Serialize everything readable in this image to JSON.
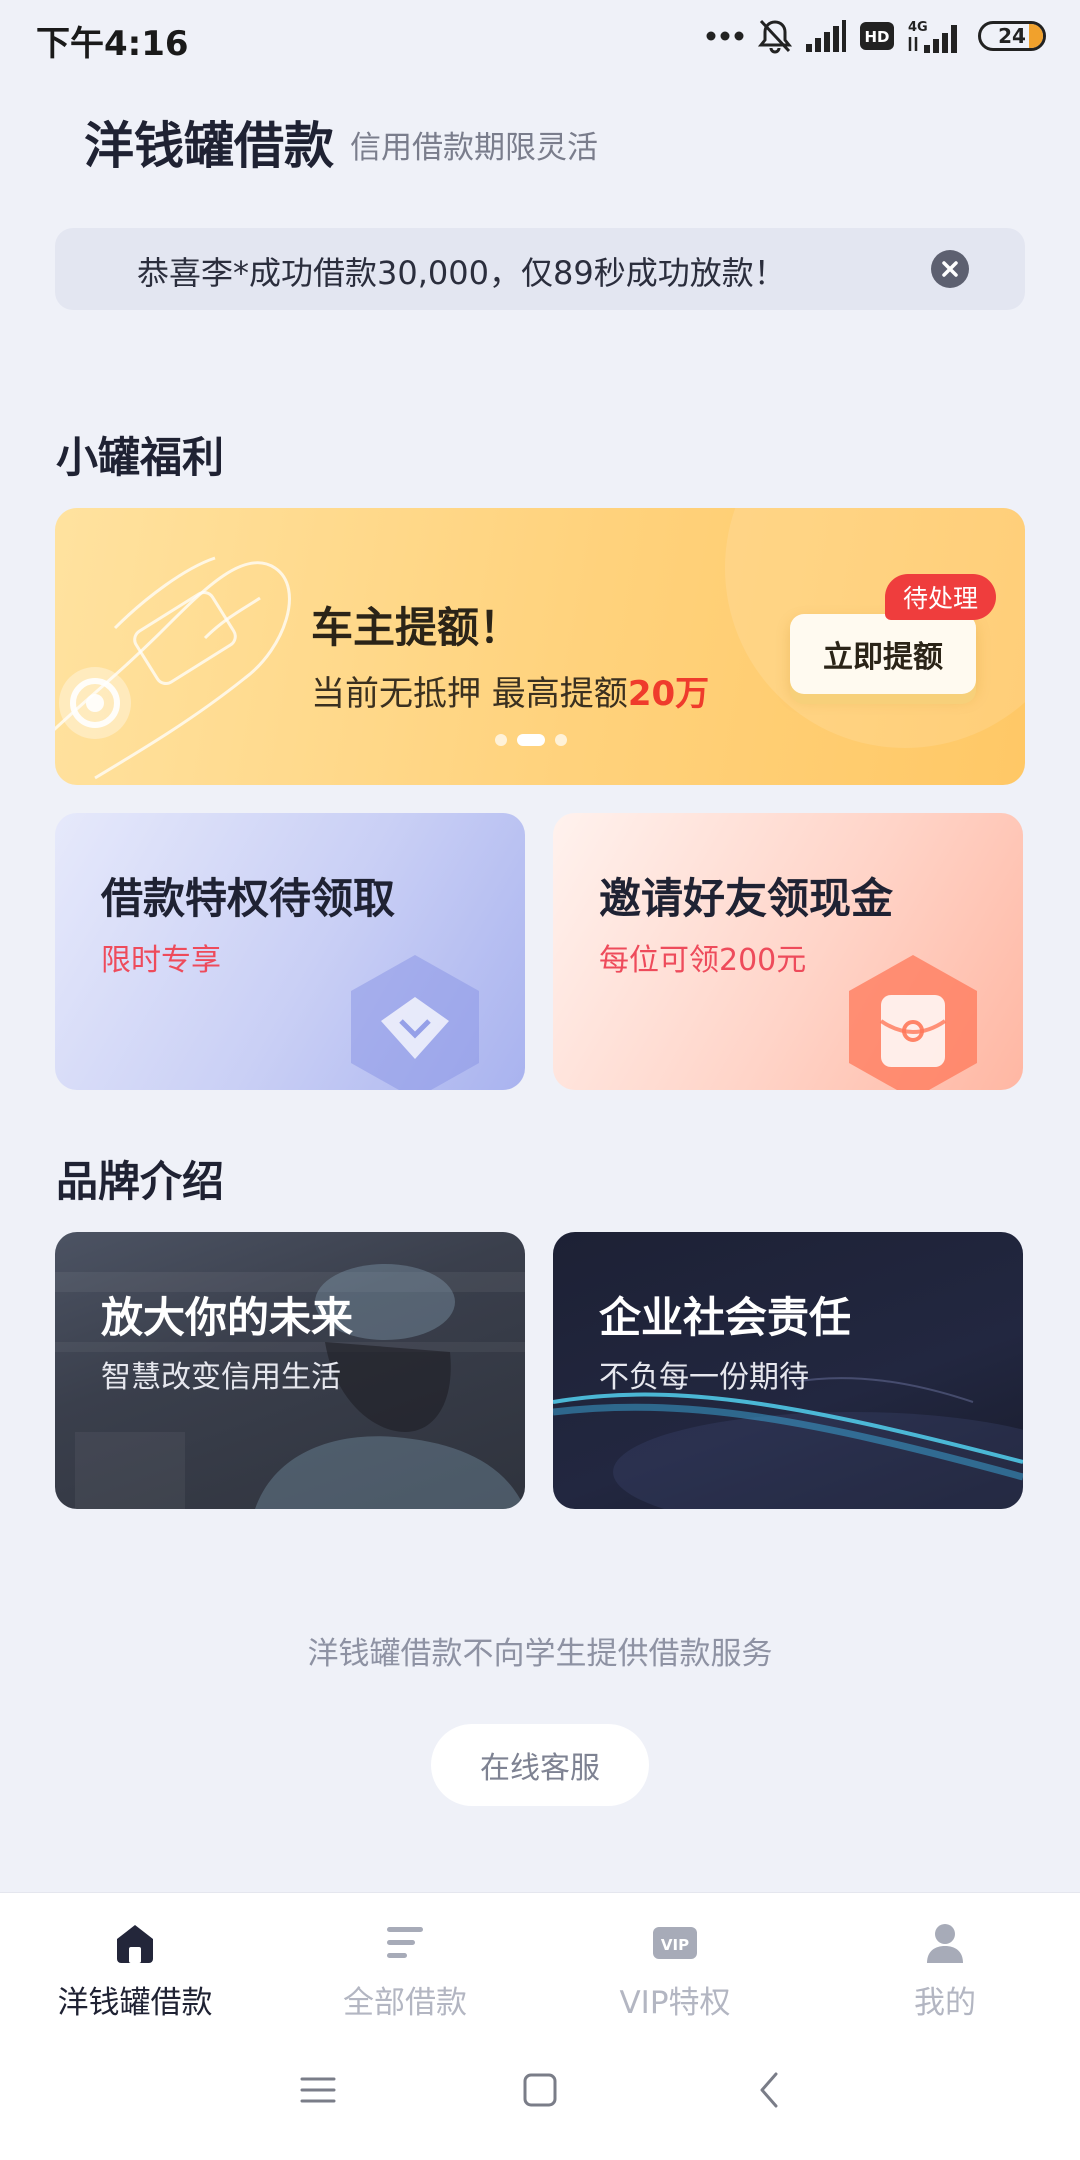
{
  "status_bar": {
    "time": "下午4:16",
    "network_label": "4G",
    "hd_label": "HD",
    "battery_level": "24",
    "icons": [
      "more-dots-icon",
      "mute-bell-icon",
      "signal-icon",
      "hd-icon",
      "signal-4g-icon",
      "battery-icon"
    ]
  },
  "header": {
    "title": "洋钱罐借款",
    "subtitle": "信用借款期限灵活"
  },
  "notice": {
    "text": "恭喜李*成功借款30,000，仅89秒成功放款！"
  },
  "welfare": {
    "section_title": "小罐福利",
    "banner": {
      "title": "车主提额！",
      "desc_prefix": "当前无抵押 最高提额",
      "desc_highlight": "20万",
      "button_label": "立即提额",
      "tag_label": "待处理",
      "page_count": 3,
      "active_page": 1
    },
    "cards": [
      {
        "title": "借款特权待领取",
        "subtitle": "限时专享",
        "icon": "diamond-icon"
      },
      {
        "title": "邀请好友领现金",
        "subtitle": "每位可领200元",
        "icon": "red-envelope-icon"
      }
    ]
  },
  "brand": {
    "section_title": "品牌介绍",
    "cards": [
      {
        "title": "放大你的未来",
        "subtitle": "智慧改变信用生活"
      },
      {
        "title": "企业社会责任",
        "subtitle": "不负每一份期待"
      }
    ]
  },
  "footer": {
    "disclaimer": "洋钱罐借款不向学生提供借款服务",
    "service_button": "在线客服"
  },
  "tab_bar": {
    "items": [
      {
        "label": "洋钱罐借款",
        "icon": "home-icon",
        "active": true
      },
      {
        "label": "全部借款",
        "icon": "list-icon",
        "active": false
      },
      {
        "label": "VIP特权",
        "icon": "vip-icon",
        "active": false
      },
      {
        "label": "我的",
        "icon": "user-icon",
        "active": false
      }
    ],
    "vip_icon_text": "VIP"
  },
  "colors": {
    "background": "#eff1f8",
    "highlight_red": "#ef3b2c",
    "banner_yellow": "#ffd27c",
    "tab_active": "#1f2233",
    "tab_inactive": "#b3b6c2"
  }
}
